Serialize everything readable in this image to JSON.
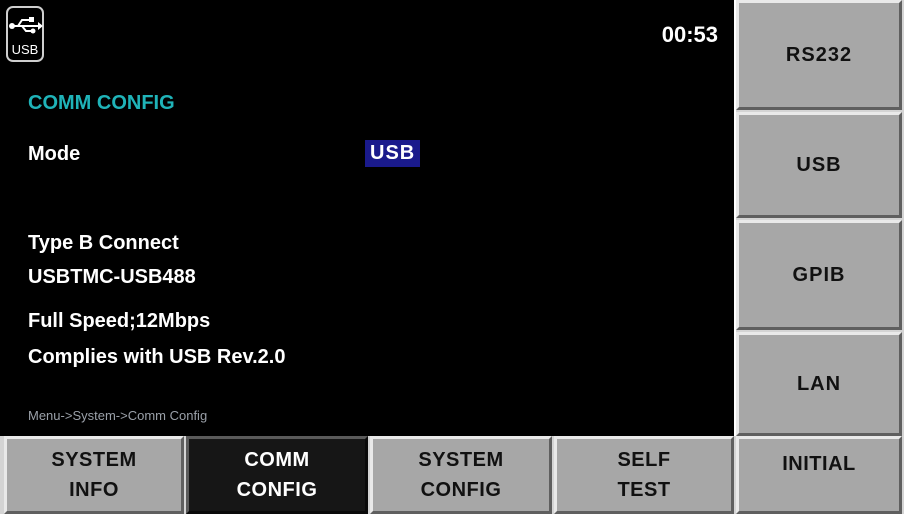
{
  "status_bar": {
    "icon": "usb-icon",
    "icon_label": "USB",
    "time": "00:53"
  },
  "screen": {
    "title": "COMM CONFIG",
    "mode_label": "Mode",
    "mode_value": "USB",
    "info_lines": [
      "Type B Connect",
      "USBTMC-USB488",
      "Full Speed;12Mbps",
      "Complies with USB Rev.2.0"
    ],
    "menu_path": "Menu->System->Comm Config"
  },
  "side_menu": [
    {
      "label": "RS232"
    },
    {
      "label": "USB"
    },
    {
      "label": "GPIB"
    },
    {
      "label": "LAN"
    }
  ],
  "bottom_menu": [
    {
      "line1": "SYSTEM",
      "line2": "INFO"
    },
    {
      "line1": "COMM",
      "line2": "CONFIG",
      "active": true
    },
    {
      "line1": "SYSTEM",
      "line2": "CONFIG"
    },
    {
      "line1": "SELF",
      "line2": "TEST"
    },
    {
      "line1": "INITIAL",
      "line2": ""
    }
  ],
  "colors": {
    "title": "#1fb3b8",
    "highlight": "#1a1a8c",
    "button": "#a7a7a7",
    "active_button": "#161616"
  }
}
